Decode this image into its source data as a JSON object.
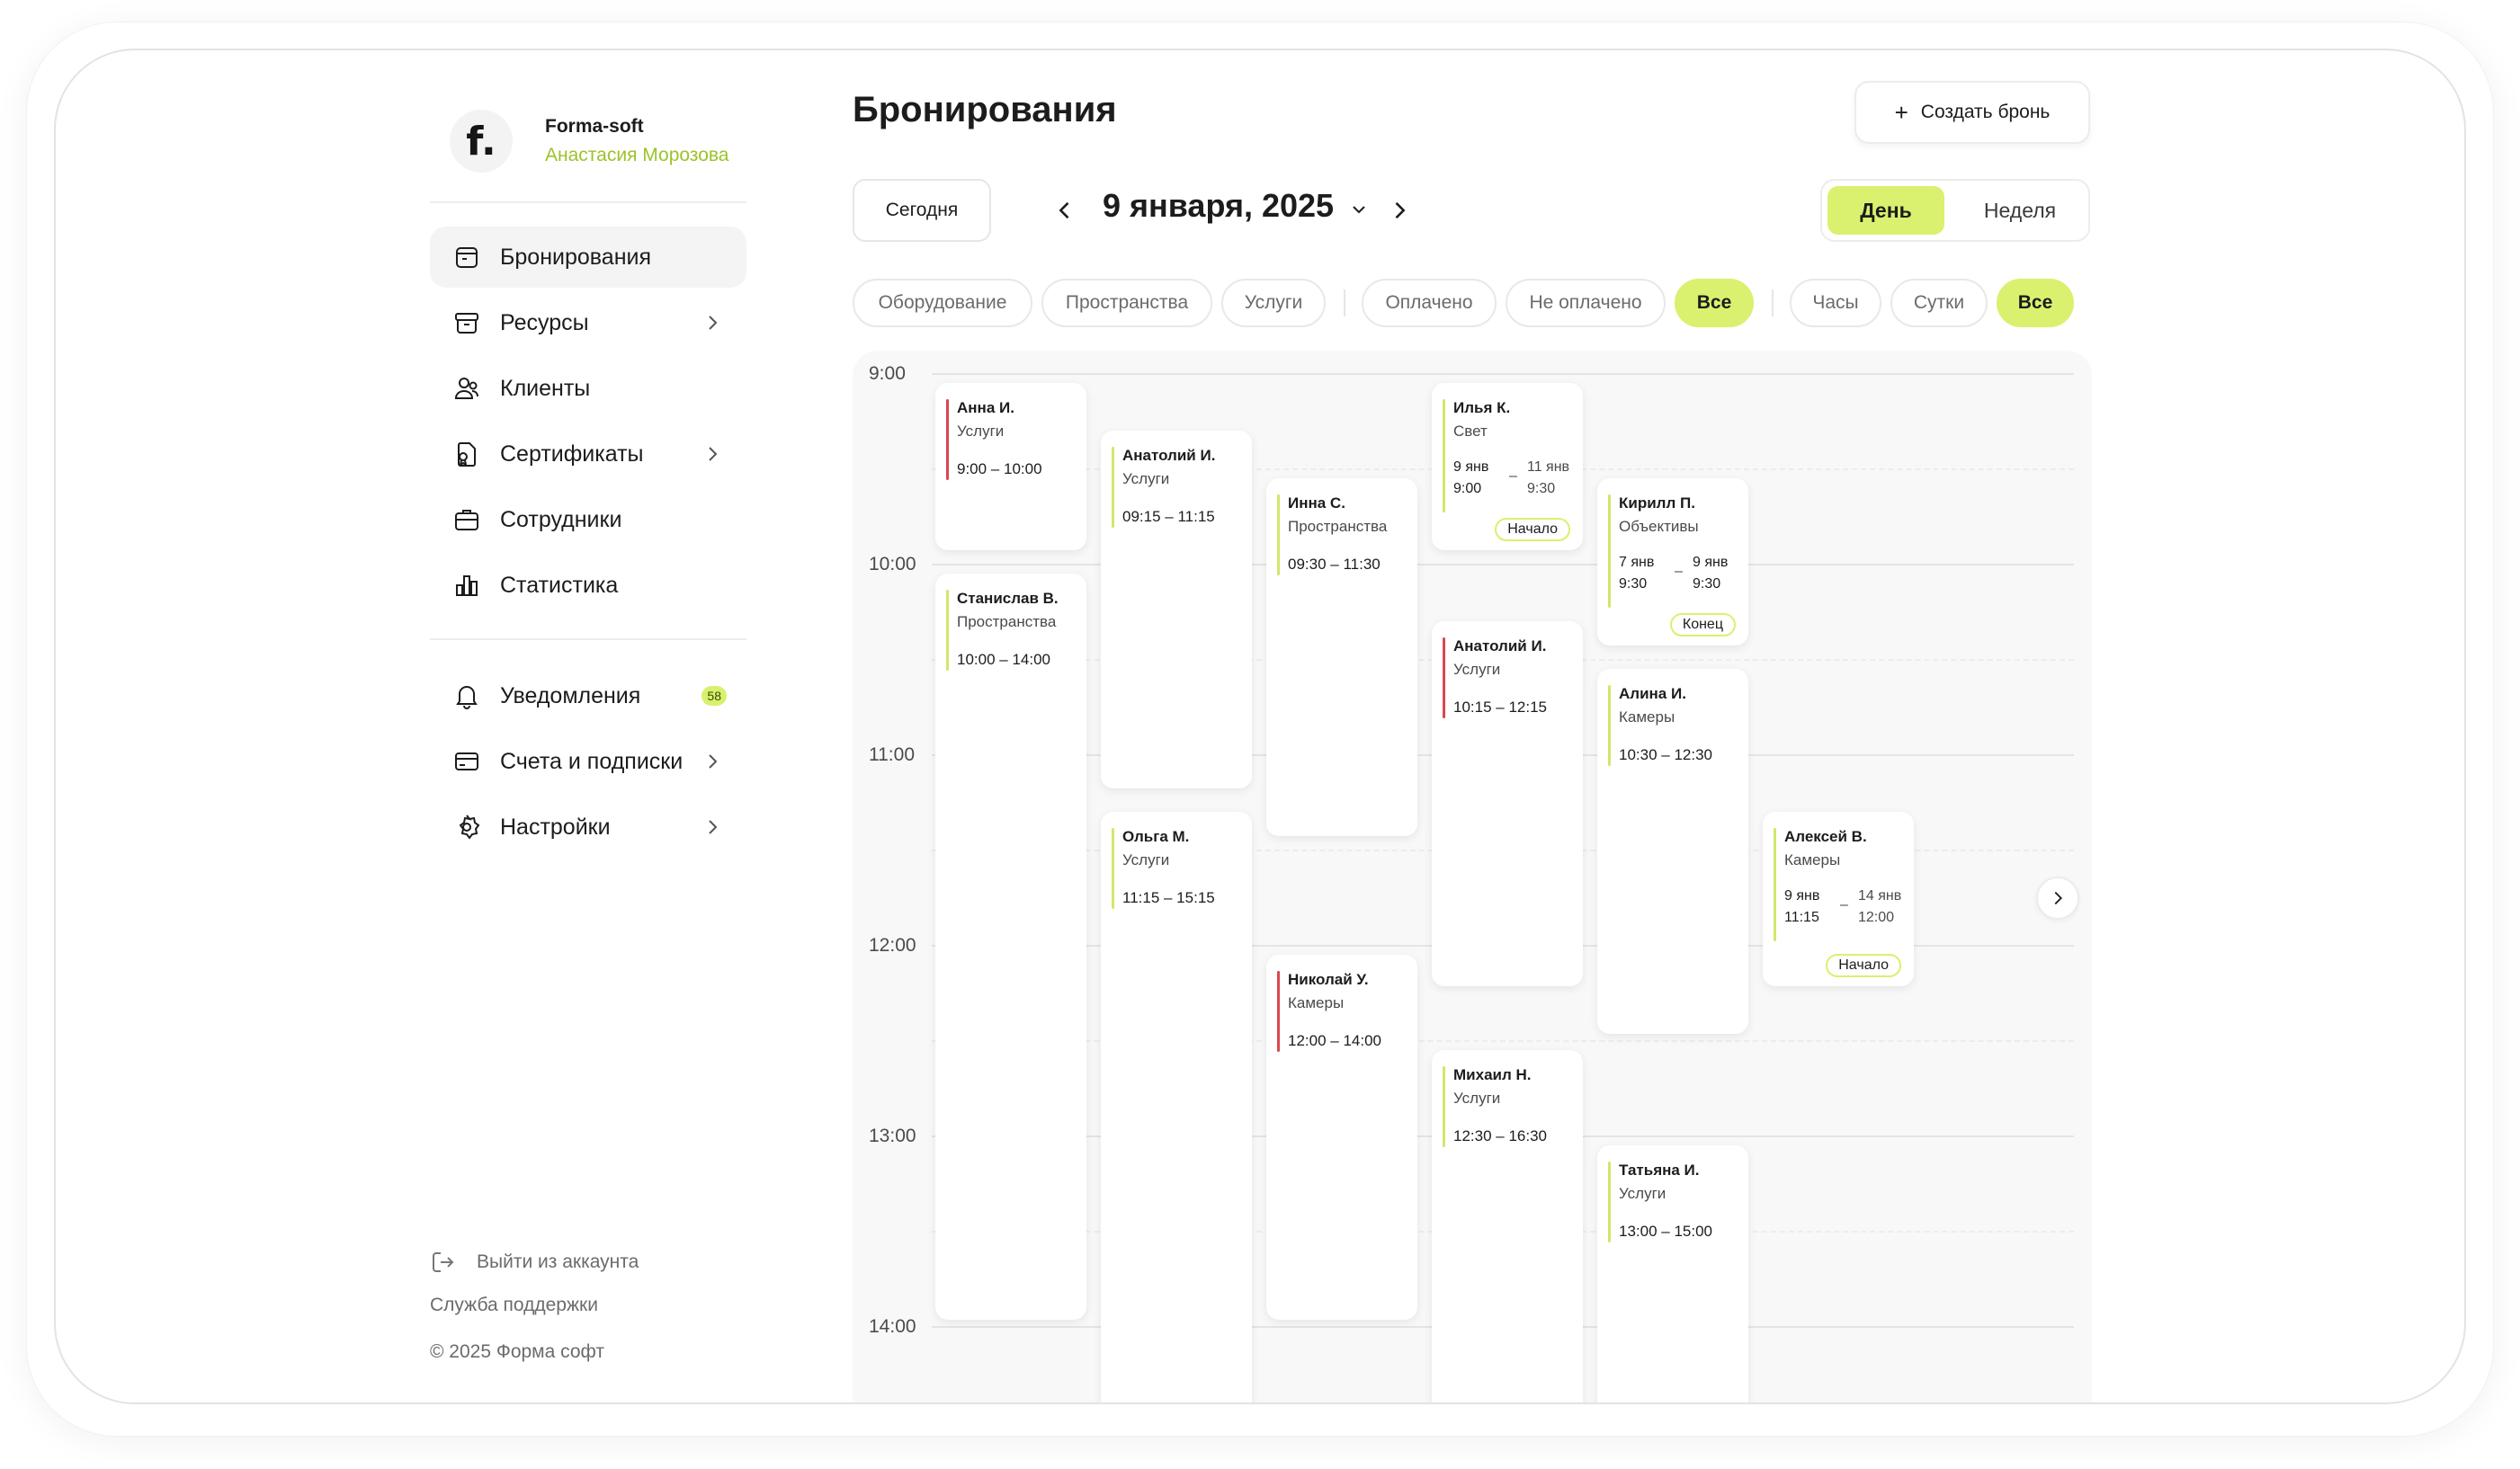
{
  "brand": {
    "logo": "f.",
    "name": "Forma-soft",
    "user": "Анастасия Морозова"
  },
  "sidebar": {
    "items": [
      {
        "label": "Бронирования",
        "icon": "calendar-icon",
        "active": true
      },
      {
        "label": "Ресурсы",
        "icon": "archive-icon",
        "has_submenu": true
      },
      {
        "label": "Клиенты",
        "icon": "users-icon"
      },
      {
        "label": "Сертификаты",
        "icon": "certificate-icon",
        "has_submenu": true
      },
      {
        "label": "Сотрудники",
        "icon": "briefcase-icon"
      },
      {
        "label": "Статистика",
        "icon": "chart-icon"
      }
    ],
    "secondary": [
      {
        "label": "Уведомления",
        "icon": "bell-icon",
        "badge": "58"
      },
      {
        "label": "Счета и подписки",
        "icon": "card-icon",
        "has_submenu": true
      },
      {
        "label": "Настройки",
        "icon": "gear-icon",
        "has_submenu": true
      }
    ],
    "footer": {
      "logout": "Выйти из аккаунта",
      "support": "Служба поддержки",
      "copyright": "© 2025 Форма софт"
    }
  },
  "header": {
    "title": "Бронирования",
    "create_label": "Создать бронь",
    "today_label": "Сегодня",
    "current_date": "9 января, 2025",
    "views": {
      "day": "День",
      "week": "Неделя",
      "selected": "День"
    }
  },
  "filters": {
    "resource_type": [
      "Оборудование",
      "Пространства",
      "Услуги"
    ],
    "payment": [
      "Оплачено",
      "Не оплачено",
      "Все"
    ],
    "duration": [
      "Часы",
      "Сутки",
      "Все"
    ],
    "selected": [
      "Все",
      "Все"
    ]
  },
  "calendar": {
    "hours": [
      "9:00",
      "10:00",
      "11:00",
      "12:00",
      "13:00",
      "14:00"
    ],
    "events": [
      {
        "name": "Анна И.",
        "category": "Услуги",
        "time": "9:00 – 10:00",
        "status_color": "#d9464f"
      },
      {
        "name": "Станислав В.",
        "category": "Пространства",
        "time": "10:00 – 14:00",
        "status_color": "#cfe86a"
      },
      {
        "name": "Анатолий И.",
        "category": "Услуги",
        "time": "09:15 – 11:15",
        "status_color": "#cfe86a"
      },
      {
        "name": "Ольга М.",
        "category": "Услуги",
        "time": "11:15 – 15:15",
        "status_color": "#cfe86a"
      },
      {
        "name": "Инна С.",
        "category": "Пространства",
        "time": "09:30 – 11:30",
        "status_color": "#cfe86a"
      },
      {
        "name": "Николай У.",
        "category": "Камеры",
        "time": "12:00 – 14:00",
        "status_color": "#d9464f"
      },
      {
        "name": "Илья К.",
        "category": "Свет",
        "from": "9 янв\n9:00",
        "to": "11 янв\n9:30",
        "tag": "Начало",
        "status_color": "#cfe86a"
      },
      {
        "name": "Анатолий И.",
        "category": "Услуги",
        "time": "10:15 – 12:15",
        "status_color": "#d9464f"
      },
      {
        "name": "Михаил Н.",
        "category": "Услуги",
        "time": "12:30 – 16:30",
        "status_color": "#cfe86a"
      },
      {
        "name": "Кирилл П.",
        "category": "Объективы",
        "from": "7 янв\n9:30",
        "to": "9 янв\n9:30",
        "tag": "Конец",
        "status_color": "#cfe86a"
      },
      {
        "name": "Алина И.",
        "category": "Камеры",
        "time": "10:30 – 12:30",
        "status_color": "#cfe86a"
      },
      {
        "name": "Татьяна И.",
        "category": "Услуги",
        "time": "13:00 – 15:00",
        "status_color": "#cfe86a"
      },
      {
        "name": "Алексей В.",
        "category": "Камеры",
        "from": "9 янв\n11:15",
        "to": "14 янв\n12:00",
        "tag": "Начало",
        "status_color": "#cfe86a"
      }
    ]
  },
  "colors": {
    "accent": "#d9f16e",
    "brand_user": "#9cc32a",
    "danger": "#d9464f"
  }
}
